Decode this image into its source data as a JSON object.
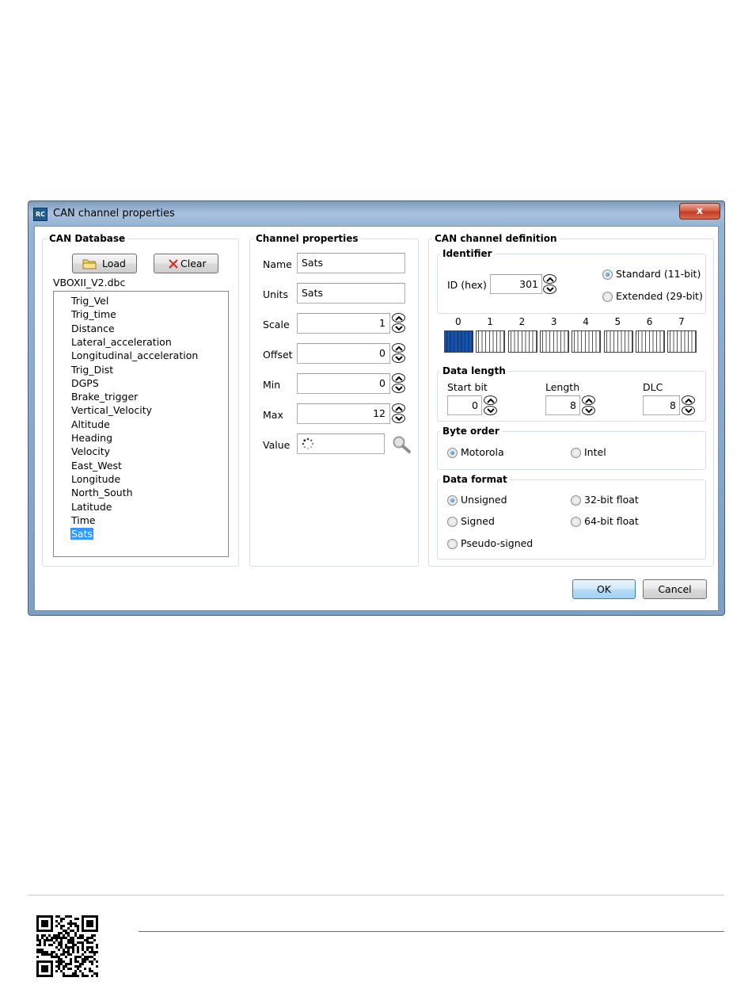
{
  "window": {
    "title": "CAN channel properties",
    "icon_text": "RC",
    "close_label": "x"
  },
  "can_database": {
    "legend": "CAN Database",
    "load_label": "Load",
    "clear_label": "Clear",
    "file_name": "VBOXII_V2.dbc",
    "items": [
      "Trig_Vel",
      "Trig_time",
      "Distance",
      "Lateral_acceleration",
      "Longitudinal_acceleration",
      "Trig_Dist",
      "DGPS",
      "Brake_trigger",
      "Vertical_Velocity",
      "Altitude",
      "Heading",
      "Velocity",
      "East_West",
      "Longitude",
      "North_South",
      "Latitude",
      "Time",
      "Sats"
    ],
    "selected": "Sats"
  },
  "channel_properties": {
    "legend": "Channel properties",
    "name_label": "Name",
    "name_value": "Sats",
    "units_label": "Units",
    "units_value": "Sats",
    "scale_label": "Scale",
    "scale_value": "1",
    "offset_label": "Offset",
    "offset_value": "0",
    "min_label": "Min",
    "min_value": "0",
    "max_label": "Max",
    "max_value": "12",
    "value_label": "Value"
  },
  "can_channel_definition": {
    "legend": "CAN channel definition",
    "identifier": {
      "legend": "Identifier",
      "id_label": "ID (hex)",
      "id_value": "301",
      "standard_label": "Standard (11-bit)",
      "extended_label": "Extended (29-bit)",
      "selected": "standard"
    },
    "bytes": {
      "labels": [
        "0",
        "1",
        "2",
        "3",
        "4",
        "5",
        "6",
        "7"
      ],
      "selected_byte": 0
    },
    "data_length": {
      "legend": "Data length",
      "start_bit_label": "Start bit",
      "start_bit_value": "0",
      "length_label": "Length",
      "length_value": "8",
      "dlc_label": "DLC",
      "dlc_value": "8"
    },
    "byte_order": {
      "legend": "Byte order",
      "motorola_label": "Motorola",
      "intel_label": "Intel",
      "selected": "motorola"
    },
    "data_format": {
      "legend": "Data format",
      "unsigned_label": "Unsigned",
      "float32_label": "32-bit float",
      "signed_label": "Signed",
      "float64_label": "64-bit float",
      "pseudo_label": "Pseudo-signed",
      "selected": "unsigned"
    }
  },
  "buttons": {
    "ok_label": "OK",
    "cancel_label": "Cancel"
  },
  "colors": {
    "accent": "#3399ff",
    "titlebar": "#93b3d3",
    "close": "#c53b22"
  }
}
